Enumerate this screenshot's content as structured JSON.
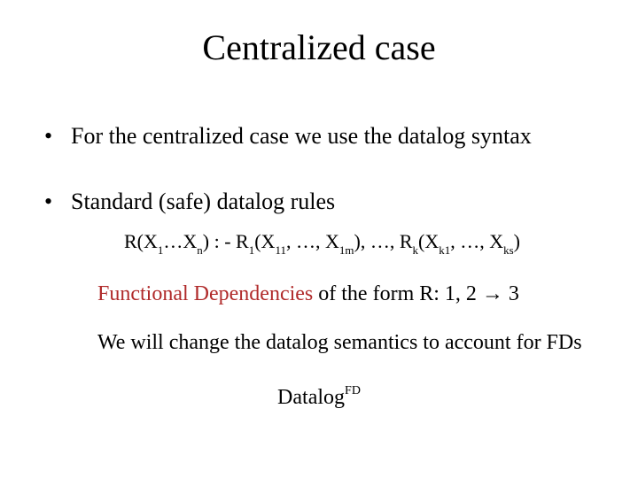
{
  "title": "Centralized case",
  "bullet1": "For the centralized case we use the datalog syntax",
  "bullet2": "Standard (safe)  datalog rules",
  "rule": {
    "p1": "R(X",
    "s1": "1",
    "p2": "…X",
    "s2": "n",
    "p3": ") : - R",
    "s3": "1",
    "p4": "(X",
    "s4": "11",
    "p5": ", …, X",
    "s5": "1m",
    "p6": "), …, R",
    "s6": "k",
    "p7": "(X",
    "s7": "k1",
    "p8": ", …, X",
    "s8": "ks",
    "p9": ")"
  },
  "fd": {
    "label": "Functional Dependencies",
    "rest": " of the form R: 1, 2 → 3"
  },
  "change_line": "We will change the datalog semantics to account for FDs",
  "datalogfd": {
    "base": "Datalog",
    "sup": "FD"
  }
}
